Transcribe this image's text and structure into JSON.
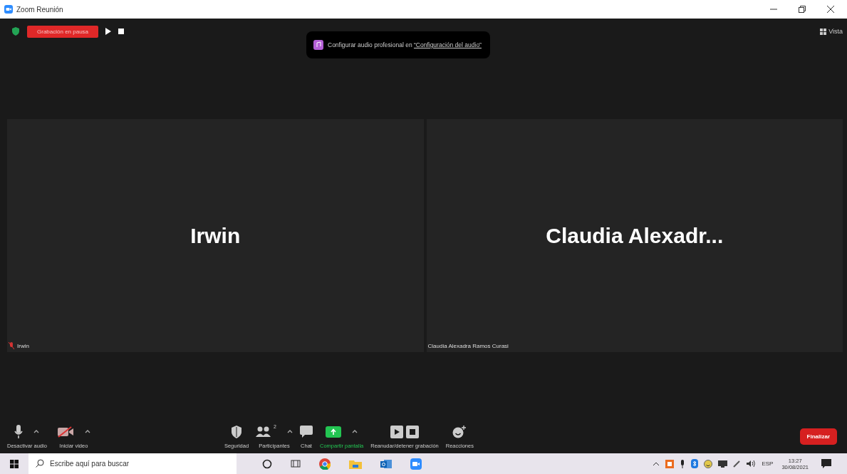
{
  "window": {
    "title": "Zoom Reunión"
  },
  "recording": {
    "status": "Grabación en pausa",
    "paused": true
  },
  "view_button": {
    "label": "Vista"
  },
  "notice": {
    "text": "Configurar audio profesional en ",
    "link": "“Configuración del audio”"
  },
  "tiles": [
    {
      "display_name": "Irwin",
      "name_label": "Irwin",
      "muted": true
    },
    {
      "display_name": "Claudia  Alexadr...",
      "name_label": "Claudia Alexadra Ramos Curasi",
      "muted": false
    }
  ],
  "toolbar": {
    "left": [
      {
        "kind": "mic",
        "label": "Desactivar audio",
        "menu": true
      },
      {
        "kind": "video",
        "label": "Iniciar video",
        "menu": true
      }
    ],
    "center": [
      {
        "kind": "security",
        "label": "Seguridad",
        "menu": false
      },
      {
        "kind": "participants",
        "label": "Participantes",
        "count": "2",
        "menu": true
      },
      {
        "kind": "chat",
        "label": "Chat",
        "menu": false
      },
      {
        "kind": "share",
        "label": "Compartir pantalla",
        "menu": true
      },
      {
        "kind": "record",
        "label": "Reanudar/detener grabación",
        "menu": false
      },
      {
        "kind": "reactions",
        "label": "Reacciones",
        "menu": false
      }
    ],
    "end_button": "Finalizar"
  },
  "taskbar": {
    "search_placeholder": "Escribe aquí para buscar",
    "apps": [
      {
        "kind": "cortana"
      },
      {
        "kind": "taskview"
      },
      {
        "kind": "chrome"
      },
      {
        "kind": "files"
      },
      {
        "kind": "outlook"
      },
      {
        "kind": "zoom"
      }
    ],
    "tray": {
      "language": "ESP",
      "time": "13:27",
      "date": "30/08/2021"
    }
  }
}
